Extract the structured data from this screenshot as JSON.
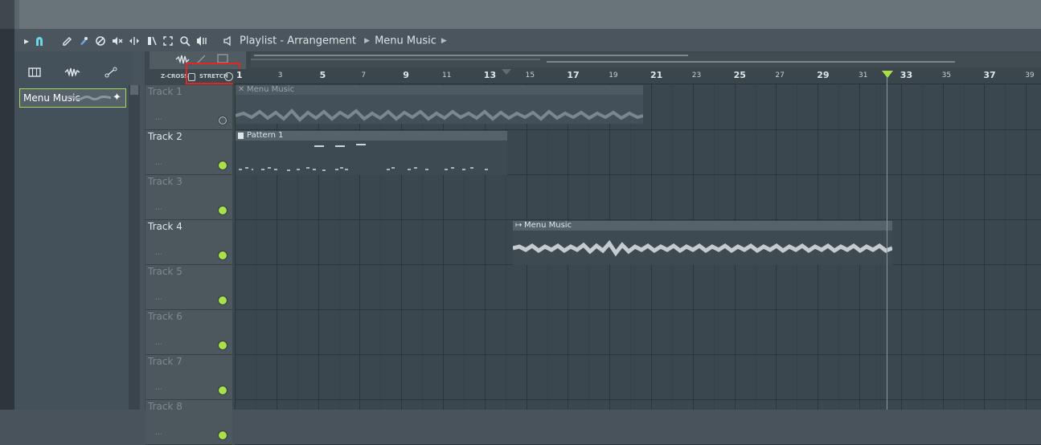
{
  "toolbar": {
    "icons": [
      "play-arrow-icon",
      "magnet-icon",
      "pencil-icon",
      "paint-brush-icon",
      "delete-icon",
      "mute-icon",
      "slip-icon",
      "slice-icon",
      "select-icon",
      "zoom-icon",
      "playback-icon",
      "speaker-icon"
    ],
    "breadcrumb": [
      "Playlist",
      "Arrangement",
      "Menu Music"
    ],
    "separator": "-"
  },
  "sidebar": {
    "tabs": [
      "piano-icon",
      "waveform-icon",
      "automation-icon"
    ],
    "items": [
      {
        "label": "Menu Music"
      }
    ]
  },
  "arrangement": {
    "zcross_label": "Z-CROSS",
    "stretch_label": "STRETCH",
    "ruler": [
      "1",
      "3",
      "5",
      "7",
      "9",
      "11",
      "13",
      "15",
      "17",
      "19",
      "21",
      "23",
      "25",
      "27",
      "29",
      "31",
      "33",
      "35",
      "37",
      "39"
    ],
    "tracks": [
      {
        "name": "Track 1",
        "dots": "...",
        "enabled": false
      },
      {
        "name": "Track 2",
        "dots": "...",
        "enabled": true
      },
      {
        "name": "Track 3",
        "dots": "...",
        "enabled": true
      },
      {
        "name": "Track 4",
        "dots": "...",
        "enabled": true
      },
      {
        "name": "Track 5",
        "dots": "...",
        "enabled": true
      },
      {
        "name": "Track 6",
        "dots": "...",
        "enabled": true
      },
      {
        "name": "Track 7",
        "dots": "...",
        "enabled": true
      },
      {
        "name": "Track 8",
        "dots": "...",
        "enabled": true
      }
    ],
    "clips": [
      {
        "label": "Menu Music",
        "icon": "close-icon",
        "muted": true
      },
      {
        "label": "Pattern 1",
        "icon": "pattern-icon",
        "muted": false
      },
      {
        "label": "Menu Music",
        "icon": "audio-clip-icon",
        "muted": false
      }
    ],
    "colors": {
      "led_on": "#a8e04a",
      "playhead_marker": "#a5e04c",
      "highlight_box": "#e22525"
    }
  }
}
